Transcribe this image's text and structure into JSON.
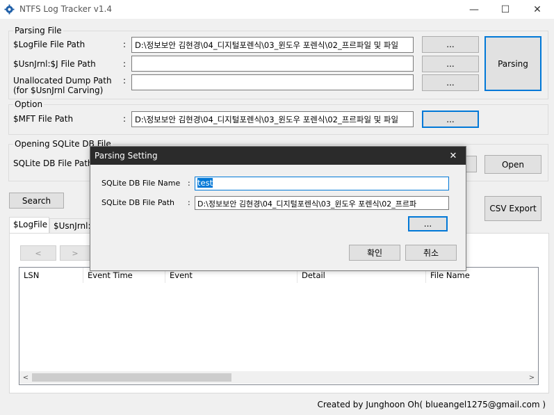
{
  "window": {
    "title": "NTFS Log Tracker v1.4",
    "minimize": "—",
    "maximize": "☐",
    "close": "✕"
  },
  "parsing_file": {
    "group_label": "Parsing File",
    "logfile_label": "$LogFile File Path",
    "logfile_colon": ":",
    "logfile_value": "D:\\정보보안 김현경\\04_디지털포렌식\\03_윈도우 포렌식\\02_프르파일 및 파일",
    "logfile_browse": "...",
    "usnjrnl_label": "$UsnJrnl:$J File Path",
    "usnjrnl_colon": ":",
    "usnjrnl_value": "",
    "usnjrnl_browse": "...",
    "unalloc_label_1": "Unallocated Dump Path",
    "unalloc_label_2": "(for $UsnJrnl Carving)",
    "unalloc_colon": ":",
    "unalloc_value": "",
    "unalloc_browse": "...",
    "parsing_button": "Parsing"
  },
  "option": {
    "group_label": "Option",
    "mft_label": "$MFT File Path",
    "mft_colon": ":",
    "mft_value": "D:\\정보보안 김현경\\04_디지털포렌식\\03_윈도우 포렌식\\02_프르파일 및 파일",
    "mft_browse": "..."
  },
  "opening_db": {
    "group_label": "Opening SQLite DB File",
    "path_label": "SQLite DB File Path",
    "open_button": "Open"
  },
  "search_button": "Search",
  "csv_export_button": "CSV Export",
  "tabs": {
    "logfile": "$LogFile",
    "usnjrnl": "$UsnJrnl:$J"
  },
  "nav": {
    "prev": "<",
    "next": ">"
  },
  "columns": {
    "lsn": "LSN",
    "event_time": "Event Time",
    "event": "Event",
    "detail": "Detail",
    "file_name": "File Name"
  },
  "scroll": {
    "left": "<",
    "right": ">"
  },
  "dialog": {
    "title": "Parsing Setting",
    "close": "✕",
    "name_label": "SQLite DB File Name",
    "name_colon": ":",
    "name_value": "test",
    "path_label": "SQLite DB File Path",
    "path_colon": ":",
    "path_value": "D:\\정보보안 김현경\\04_디지털포렌식\\03_윈도우 포렌식\\02_프르파",
    "browse": "...",
    "ok": "확인",
    "cancel": "취소"
  },
  "footer": "Created by Junghoon Oh( blueangel1275@gmail.com )",
  "colors": {
    "focus_border": "#0078d7",
    "dialog_titlebar": "#2b2b2b",
    "selection": "#0078d7"
  }
}
